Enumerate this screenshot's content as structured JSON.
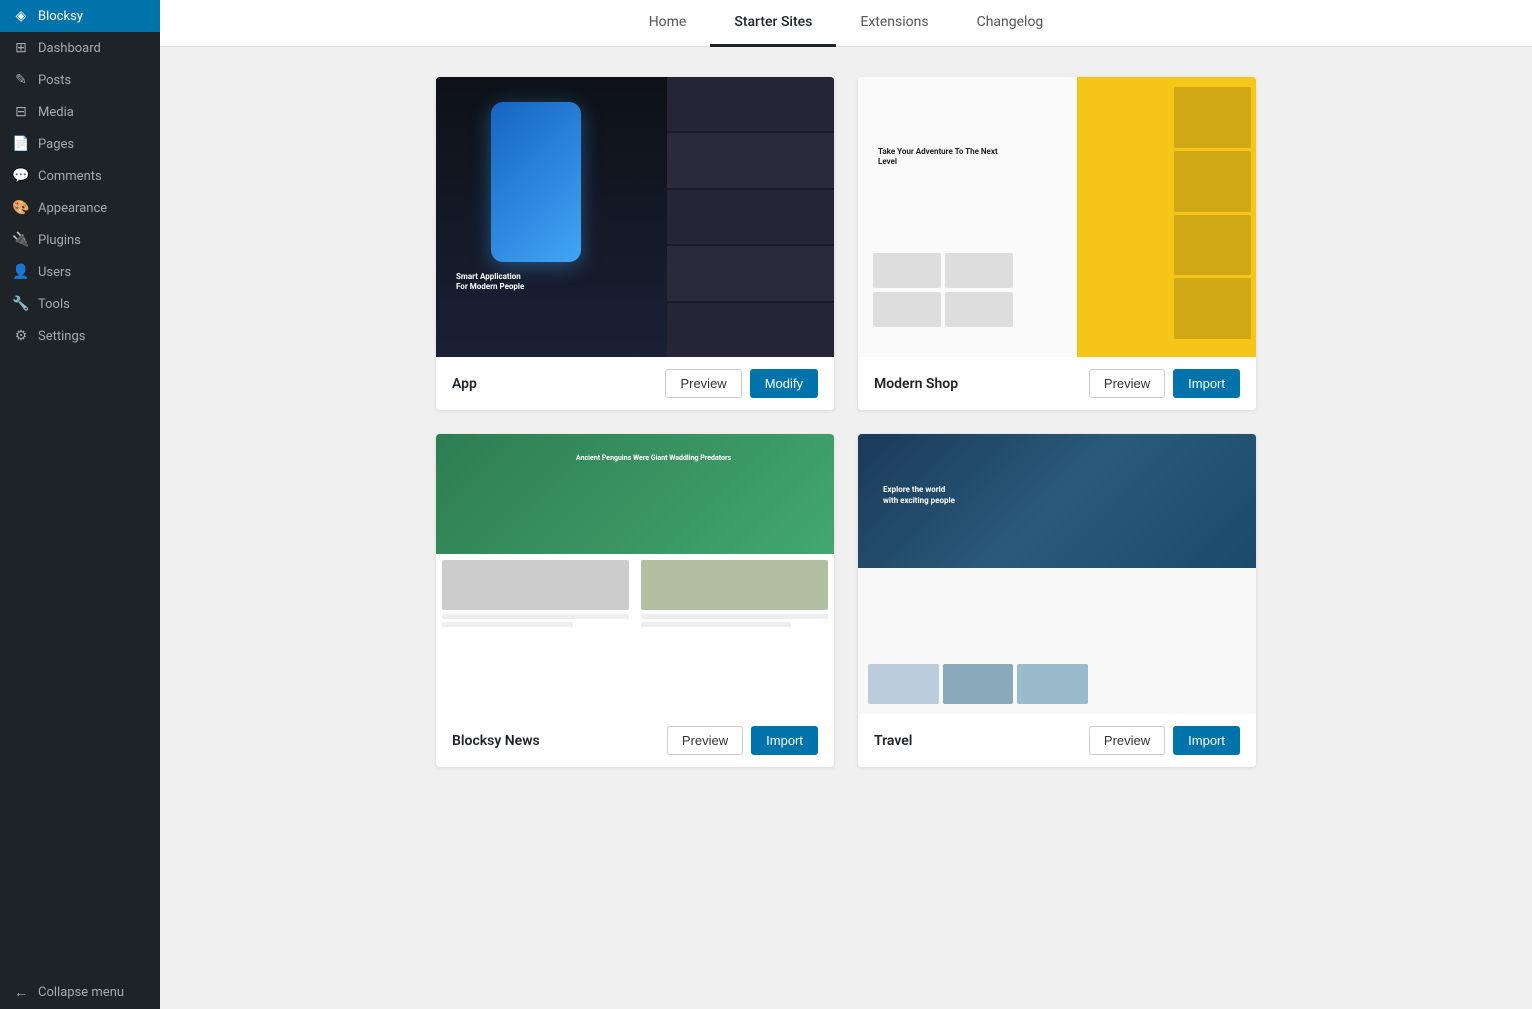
{
  "sidebar": {
    "items": [
      {
        "id": "dashboard",
        "label": "Dashboard",
        "icon": "⊞"
      },
      {
        "id": "blocksy",
        "label": "Blocksy",
        "icon": "◈",
        "active": true
      },
      {
        "id": "posts",
        "label": "Posts",
        "icon": "✎"
      },
      {
        "id": "media",
        "label": "Media",
        "icon": "⊟"
      },
      {
        "id": "pages",
        "label": "Pages",
        "icon": "📄"
      },
      {
        "id": "comments",
        "label": "Comments",
        "icon": "💬"
      },
      {
        "id": "appearance",
        "label": "Appearance",
        "icon": "🎨"
      },
      {
        "id": "plugins",
        "label": "Plugins",
        "icon": "🔌"
      },
      {
        "id": "users",
        "label": "Users",
        "icon": "👤"
      },
      {
        "id": "tools",
        "label": "Tools",
        "icon": "🔧"
      },
      {
        "id": "settings",
        "label": "Settings",
        "icon": "⚙"
      },
      {
        "id": "collapse",
        "label": "Collapse menu",
        "icon": "←"
      }
    ]
  },
  "tabs": [
    {
      "id": "home",
      "label": "Home"
    },
    {
      "id": "starter-sites",
      "label": "Starter Sites",
      "active": true
    },
    {
      "id": "extensions",
      "label": "Extensions"
    },
    {
      "id": "changelog",
      "label": "Changelog"
    }
  ],
  "sites": [
    {
      "id": "app",
      "name": "App",
      "preview_type": "app",
      "actions": [
        {
          "id": "preview",
          "label": "Preview",
          "type": "outline"
        },
        {
          "id": "modify",
          "label": "Modify",
          "type": "primary"
        }
      ]
    },
    {
      "id": "modern-shop",
      "name": "Modern Shop",
      "preview_type": "shop",
      "actions": [
        {
          "id": "preview",
          "label": "Preview",
          "type": "outline"
        },
        {
          "id": "import",
          "label": "Import",
          "type": "primary"
        }
      ]
    },
    {
      "id": "blocksy-news",
      "name": "Blocksy News",
      "preview_type": "news",
      "actions": [
        {
          "id": "preview",
          "label": "Preview",
          "type": "outline"
        },
        {
          "id": "import",
          "label": "Import",
          "type": "primary"
        }
      ]
    },
    {
      "id": "travel",
      "name": "Travel",
      "preview_type": "travel",
      "actions": [
        {
          "id": "preview",
          "label": "Preview",
          "type": "outline"
        },
        {
          "id": "import",
          "label": "Import",
          "type": "primary"
        }
      ]
    }
  ]
}
